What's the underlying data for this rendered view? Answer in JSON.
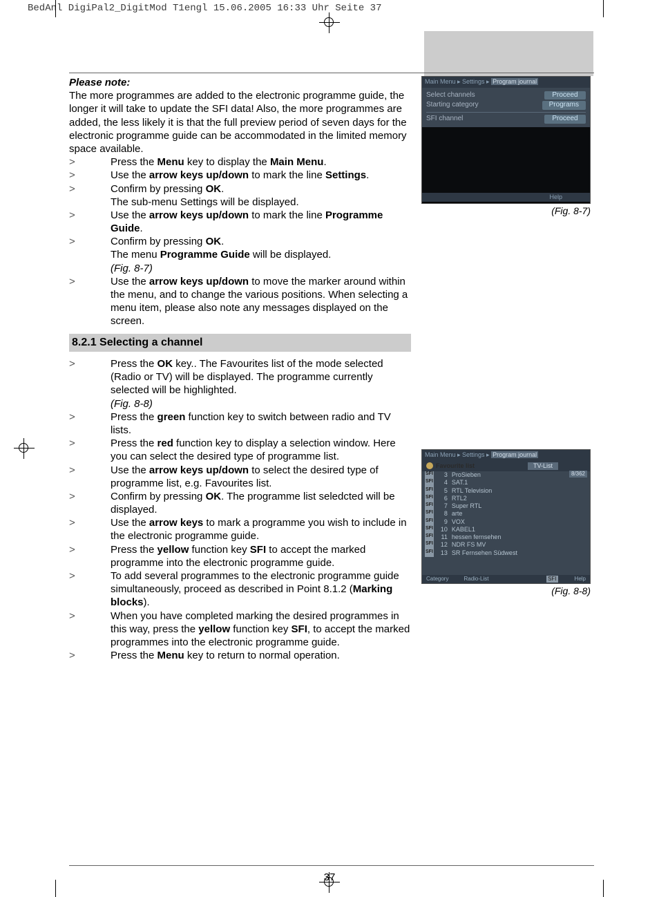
{
  "header": "BedAnl DigiPal2_DigitMod T1engl  15.06.2005  16:33 Uhr  Seite 37",
  "note_title": "Please note:",
  "note_body": "The more programmes are added to the electronic programme guide, the longer it will take to update the SFI data! Also, the more programmes are added, the less likely it is that the full preview period of seven days for the electronic programme guide can be accommodated in the limited memory space available.",
  "steps_a": [
    {
      "pre": "Press the ",
      "b1": "Menu",
      "mid": " key to display the ",
      "b2": "Main Menu",
      "post": "."
    },
    {
      "pre": "Use the ",
      "b1": "arrow keys up/down",
      "mid": " to mark the line ",
      "b2": "Settings",
      "post": "."
    },
    {
      "pre": "Confirm by pressing ",
      "b1": "OK",
      "mid": ".",
      "b2": "",
      "post": "",
      "after": "The sub-menu Settings will be displayed."
    },
    {
      "pre": "Use the ",
      "b1": "arrow keys up/down",
      "mid": " to mark the line ",
      "b2": "Programme Guide",
      "post": "."
    },
    {
      "pre": "Confirm by pressing ",
      "b1": "OK",
      "mid": ".",
      "b2": "",
      "post": "",
      "after_pre": "The menu ",
      "after_b": "Programme Guide",
      "after_post": " will be displayed.",
      "after_italic": "(Fig. 8-7)"
    },
    {
      "pre": "Use the ",
      "b1": "arrow keys up/down",
      "mid": " to move the marker around within the menu, and to change the various positions. When selecting a menu item, please also note any messages displayed on the screen.",
      "b2": "",
      "post": ""
    }
  ],
  "section_heading": "8.2.1 Selecting a channel",
  "steps_b": [
    {
      "pre": "Press the ",
      "b1": "OK",
      "mid": " key.. The Favourites list of the mode selected (Radio or TV) will be displayed. The programme currently selected will be highlighted.",
      "b2": "",
      "post": "",
      "after_italic": "(Fig. 8-8)"
    },
    {
      "pre": "Press the ",
      "b1": "green",
      "mid": " function key to switch between radio and TV lists.",
      "b2": "",
      "post": ""
    },
    {
      "pre": "Press the ",
      "b1": "red",
      "mid": " function key to display a selection window. Here you can select the desired type of programme list.",
      "b2": "",
      "post": ""
    },
    {
      "pre": "Use the ",
      "b1": "arrow keys up/down",
      "mid": " to select the desired type of programme list, e.g. Favourites list.",
      "b2": "",
      "post": ""
    },
    {
      "pre": "Confirm by pressing ",
      "b1": "OK",
      "mid": ". The programme list seledcted will be displayed.",
      "b2": "",
      "post": ""
    },
    {
      "pre": "Use the ",
      "b1": "arrow keys",
      "mid": " to mark a programme you wish to include in the electronic programme guide.",
      "b2": "",
      "post": ""
    },
    {
      "pre": "Press the ",
      "b1": "yellow",
      "mid": " function key ",
      "b2": "SFI",
      "post": " to accept the marked programme into the electronic programme guide."
    },
    {
      "pre": "To add several programmes to the electronic programme guide simultaneously, proceed as described in Point 8.1.2 (",
      "b1": "Marking blocks",
      "mid": ").",
      "b2": "",
      "post": ""
    },
    {
      "pre": "When you have completed marking the desired programmes in this way, press the ",
      "b1": "yellow",
      "mid": " function key ",
      "b2": "SFI",
      "post": ", to accept the marked programmes into the electronic programme guide."
    },
    {
      "pre": "Press the ",
      "b1": "Menu",
      "mid": " key to return to normal operation.",
      "b2": "",
      "post": ""
    }
  ],
  "fig1": {
    "breadcrumb_pre": "Main Menu ▸ Settings ▸ ",
    "breadcrumb_hl": "Program journal",
    "rows": [
      {
        "label": "Select channels",
        "btn": "Proceed"
      },
      {
        "label": "Starting category",
        "btn": "Programs"
      }
    ],
    "row_sep": {
      "label": "SFI channel",
      "btn": "Proceed"
    },
    "foot": "Help",
    "caption": "(Fig. 8-7)"
  },
  "fig2": {
    "breadcrumb_pre": "Main Menu ▸ Settings ▸ ",
    "breadcrumb_hl": "Program journal",
    "fav": "Favourite list",
    "tvlist": "TV-List",
    "count": "8/362",
    "channels": [
      {
        "n": "3",
        "name": "ProSieben"
      },
      {
        "n": "4",
        "name": "SAT.1"
      },
      {
        "n": "5",
        "name": "RTL Television"
      },
      {
        "n": "6",
        "name": "RTL2"
      },
      {
        "n": "7",
        "name": "Super RTL"
      },
      {
        "n": "8",
        "name": "arte"
      },
      {
        "n": "9",
        "name": "VOX"
      },
      {
        "n": "10",
        "name": "KABEL1"
      },
      {
        "n": "11",
        "name": "hessen fernsehen"
      },
      {
        "n": "12",
        "name": "NDR FS MV"
      },
      {
        "n": "13",
        "name": "SR Fernsehen Südwest"
      }
    ],
    "foot": {
      "a": "Category",
      "b": "Radio-List",
      "c": "SFI",
      "d": "Help"
    },
    "caption": "(Fig. 8-8)"
  },
  "page_number": "37",
  "step_marker": ">"
}
